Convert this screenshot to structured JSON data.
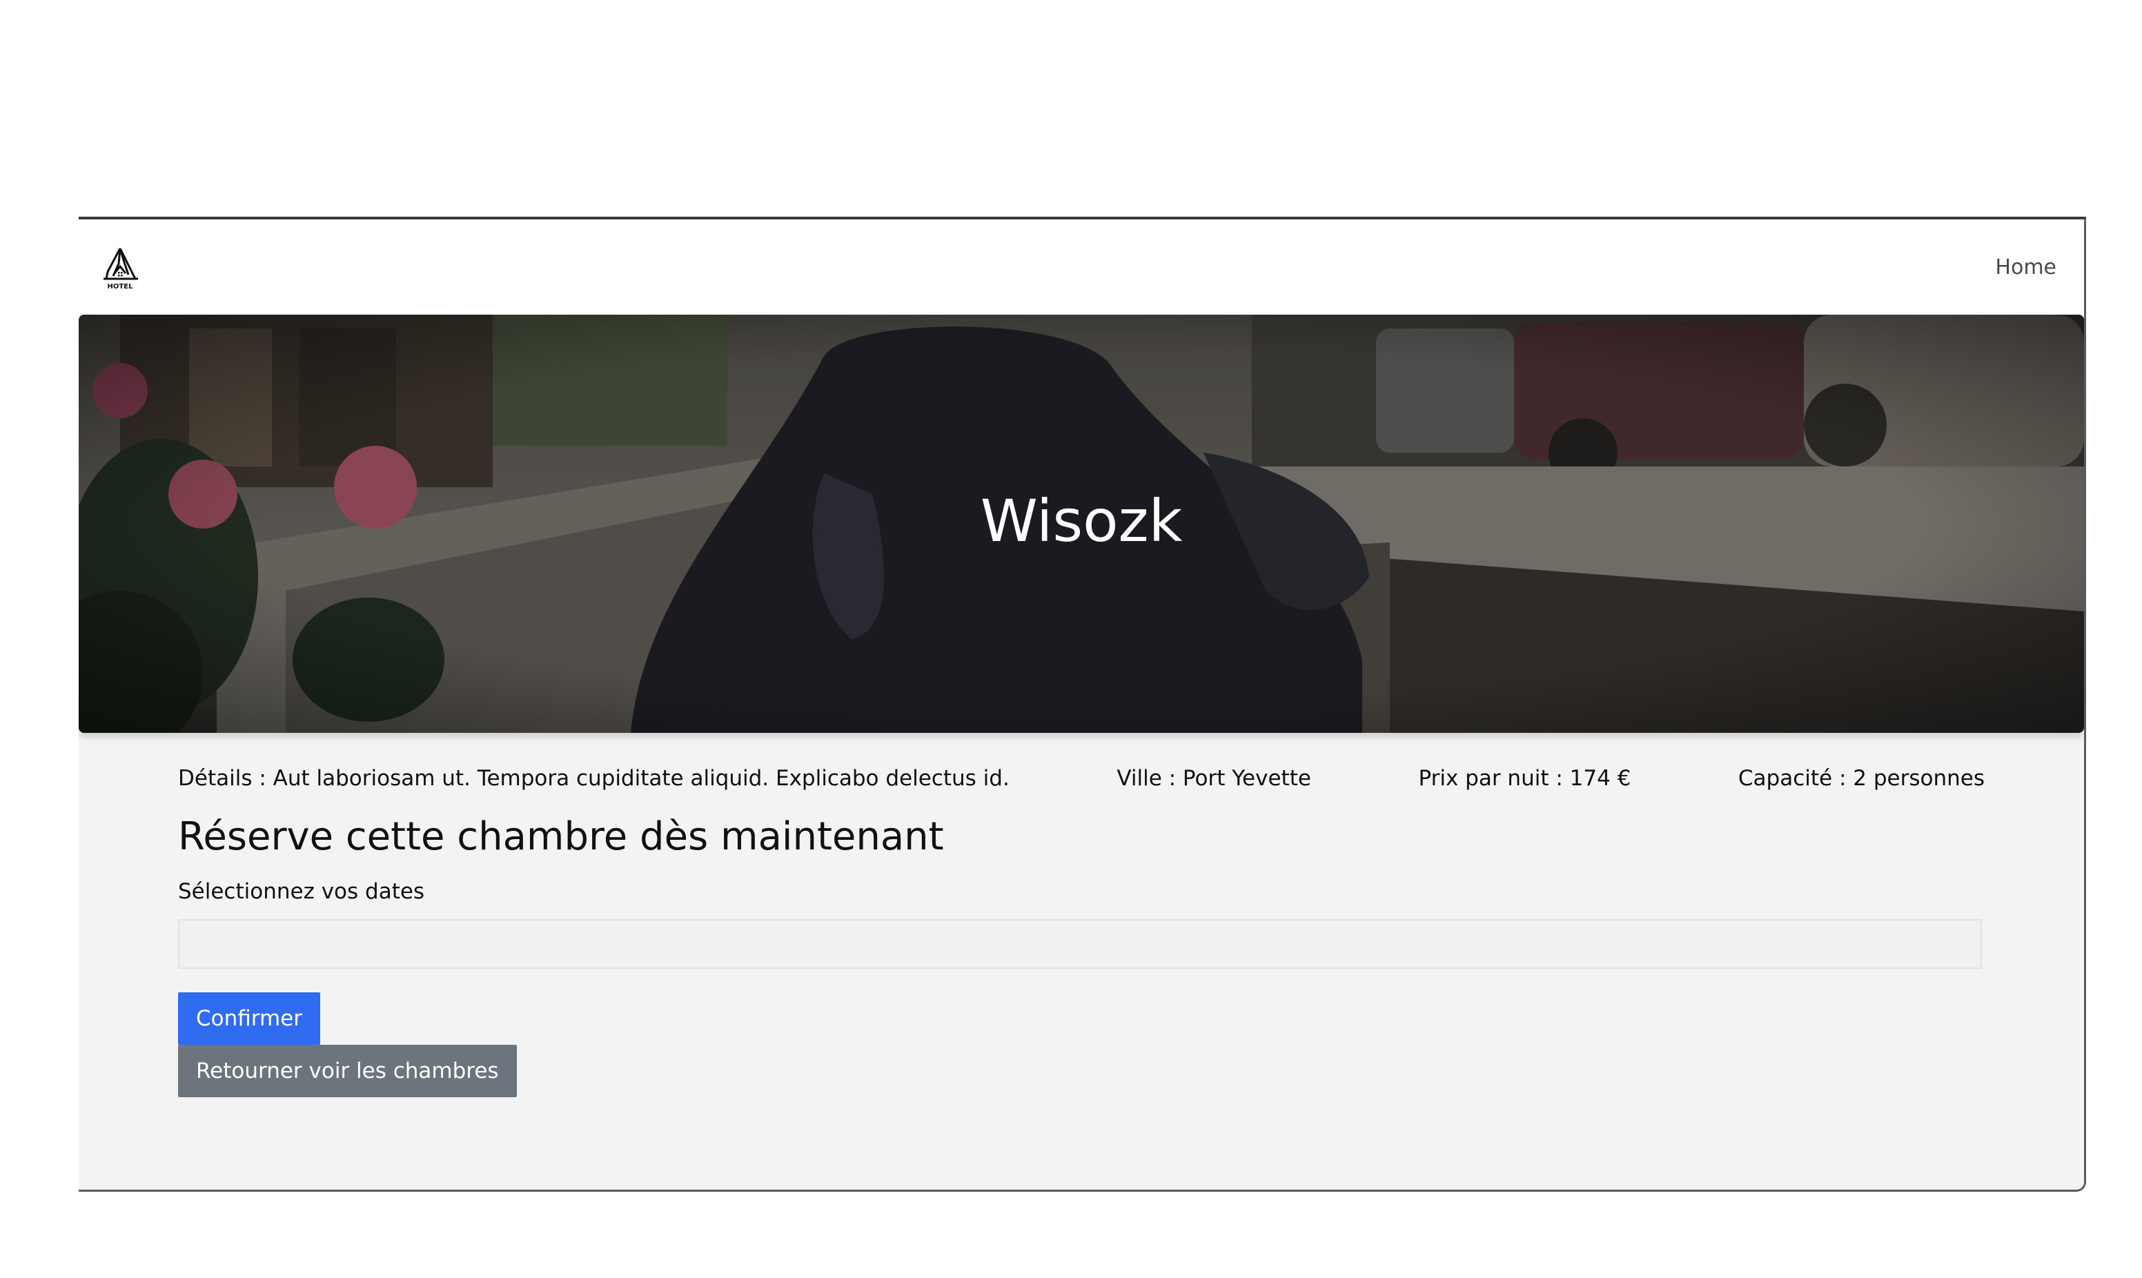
{
  "navbar": {
    "logo_text": "HOTEL",
    "home_label": "Home"
  },
  "hero": {
    "title": "Wisozk"
  },
  "details": {
    "description": "Détails : Aut laboriosam ut. Tempora cupiditate aliquid. Explicabo delectus id.",
    "city": "Ville : Port Yevette",
    "price": "Prix par nuit : 174 €",
    "capacity": "Capacité : 2 personnes"
  },
  "booking": {
    "title": "Réserve cette chambre dès maintenant",
    "dates_label": "Sélectionnez vos dates",
    "dates_value": "",
    "confirm_label": "Confirmer",
    "back_label": "Retourner voir les chambres"
  },
  "colors": {
    "primary": "#2f6cf0",
    "secondary": "#6c757d",
    "background": "#f3f3f3"
  }
}
